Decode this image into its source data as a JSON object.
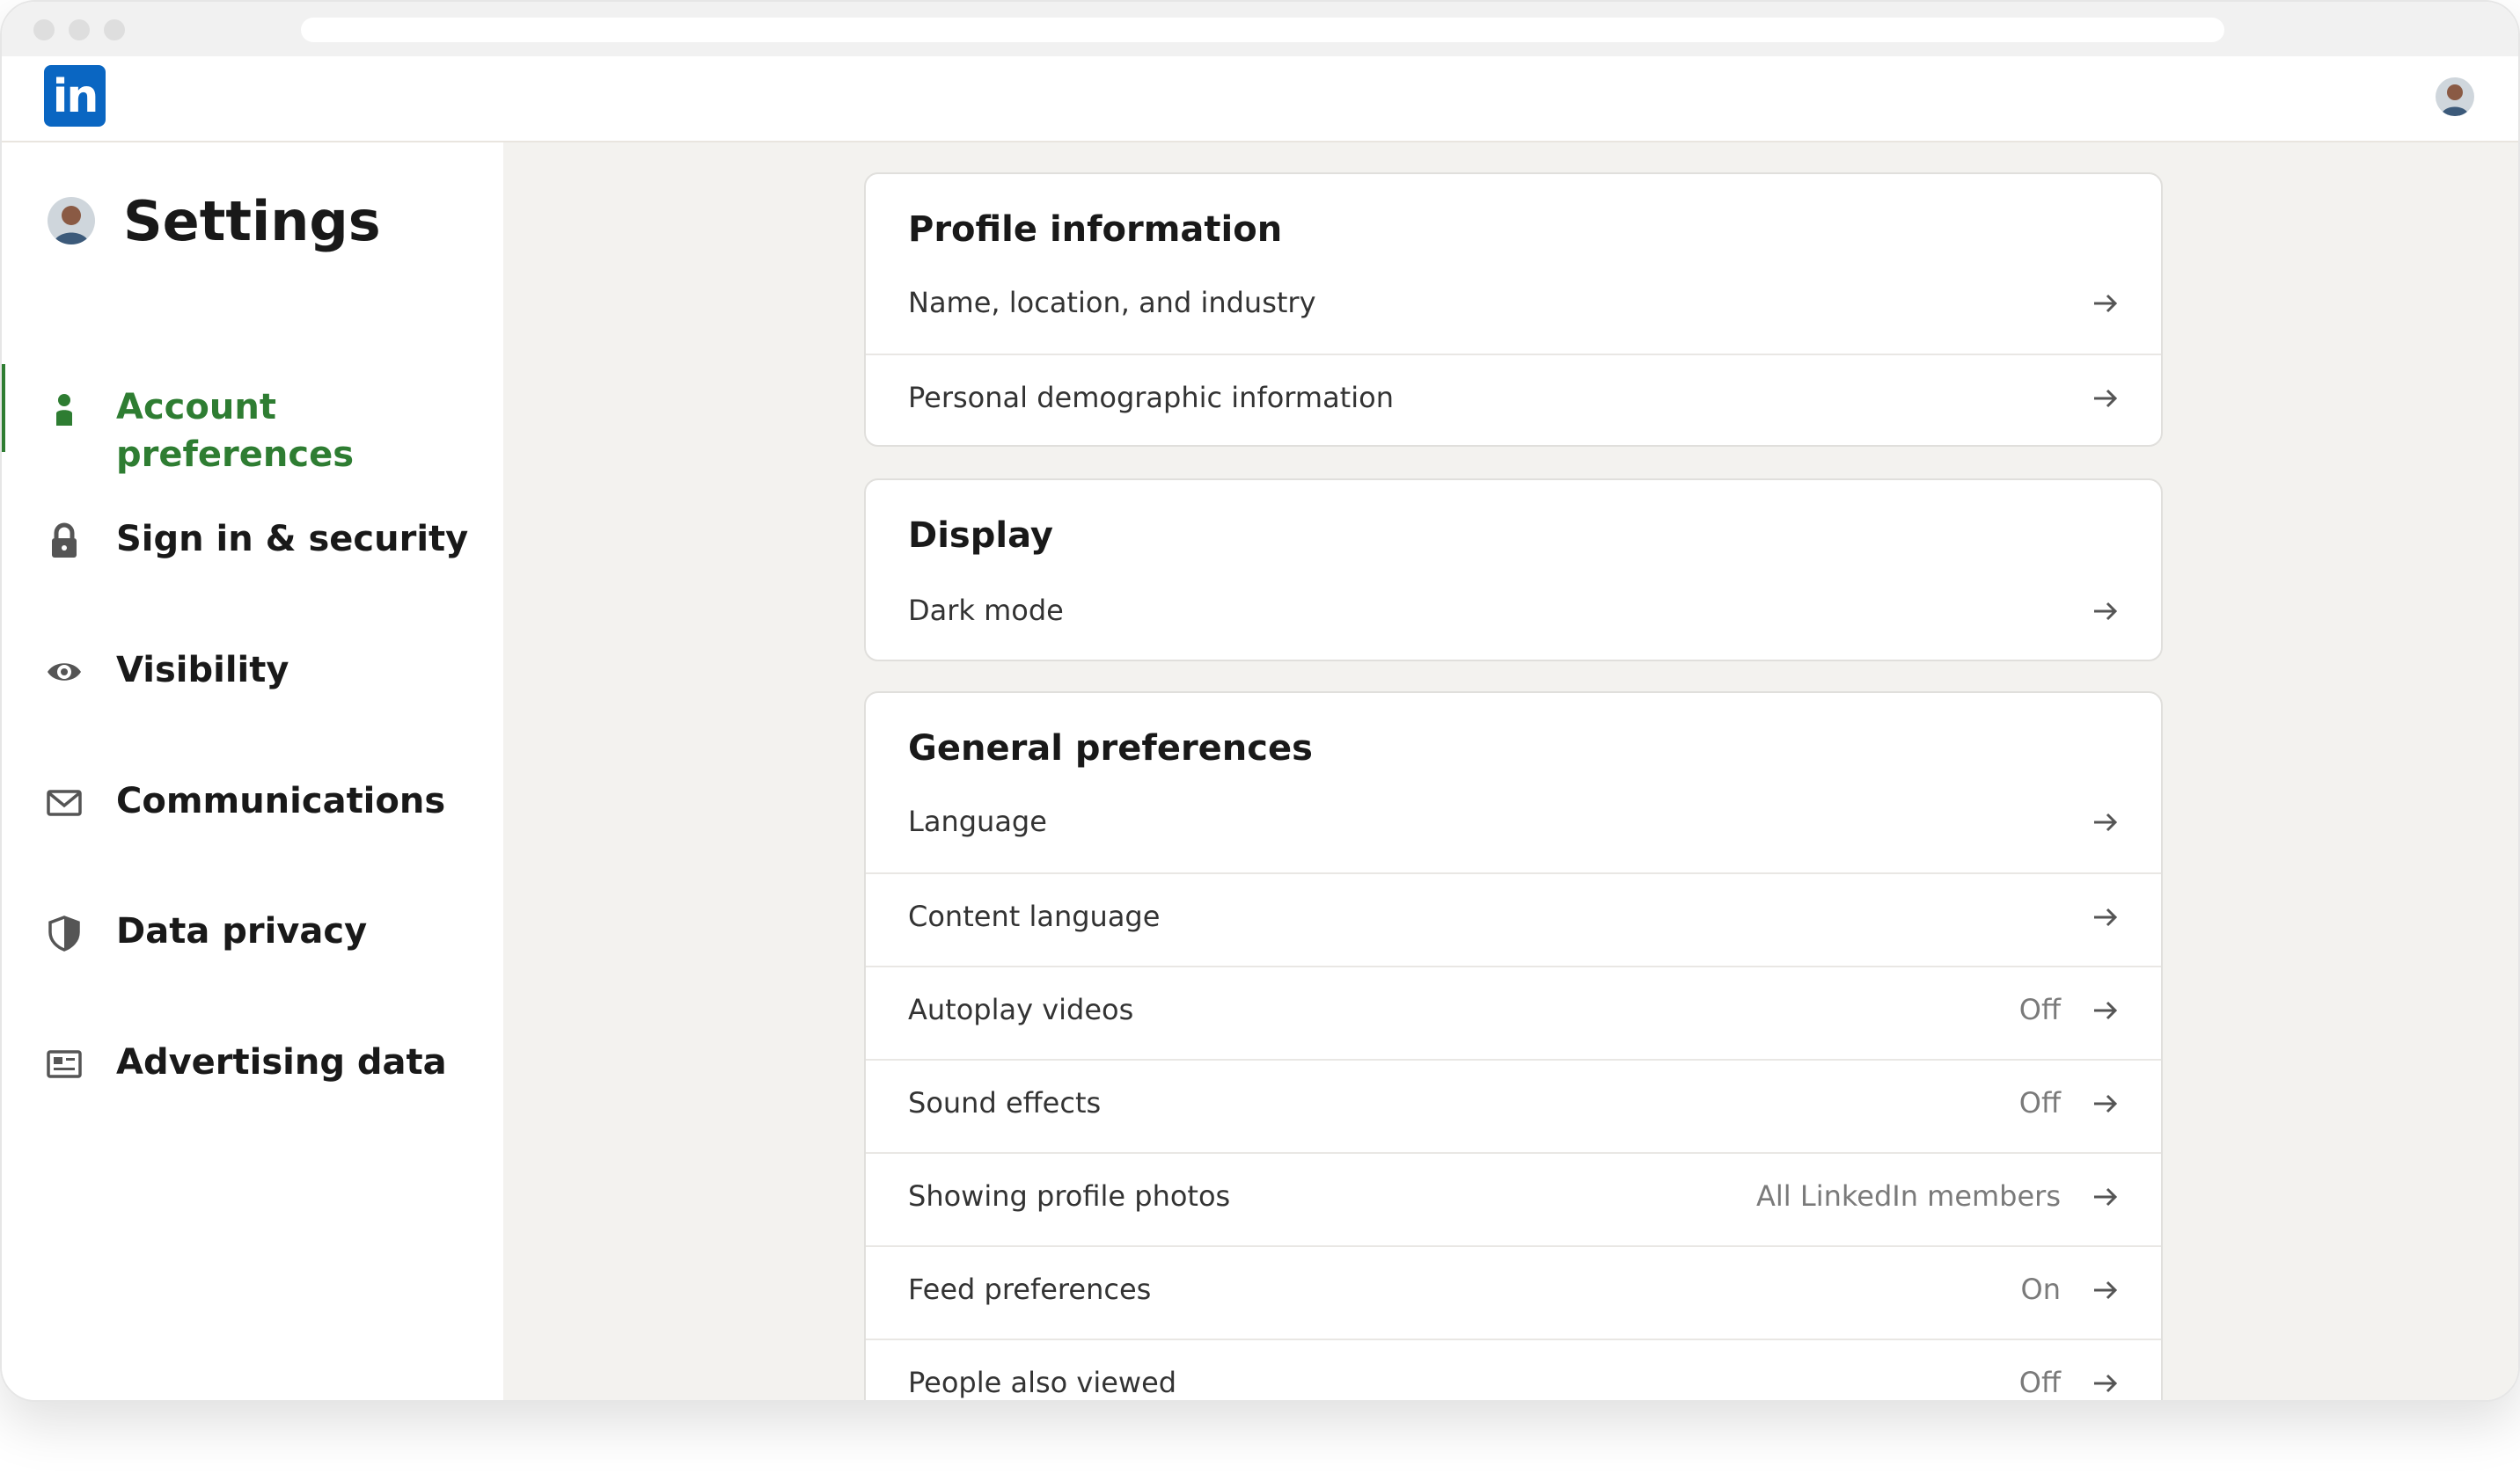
{
  "topnav": {
    "logo_text": "in"
  },
  "sidebar": {
    "title": "Settings",
    "accent_color": "#2e7d32",
    "items": [
      {
        "label": "Account preferences",
        "icon": "person-icon",
        "active": true
      },
      {
        "label": "Sign in & security",
        "icon": "lock-icon",
        "active": false
      },
      {
        "label": "Visibility",
        "icon": "eye-icon",
        "active": false
      },
      {
        "label": "Communications",
        "icon": "envelope-icon",
        "active": false
      },
      {
        "label": "Data privacy",
        "icon": "shield-icon",
        "active": false
      },
      {
        "label": "Advertising data",
        "icon": "ad-icon",
        "active": false
      }
    ]
  },
  "sections": [
    {
      "title": "Profile information",
      "rows": [
        {
          "label": "Name, location, and industry",
          "value": ""
        },
        {
          "label": "Personal demographic information",
          "value": ""
        }
      ]
    },
    {
      "title": "Display",
      "rows": [
        {
          "label": "Dark mode",
          "value": ""
        }
      ]
    },
    {
      "title": "General preferences",
      "rows": [
        {
          "label": "Language",
          "value": ""
        },
        {
          "label": "Content language",
          "value": ""
        },
        {
          "label": "Autoplay videos",
          "value": "Off"
        },
        {
          "label": "Sound effects",
          "value": "Off"
        },
        {
          "label": "Showing profile photos",
          "value": "All LinkedIn members"
        },
        {
          "label": "Feed preferences",
          "value": "On"
        },
        {
          "label": "People also viewed",
          "value": "Off"
        }
      ]
    }
  ]
}
